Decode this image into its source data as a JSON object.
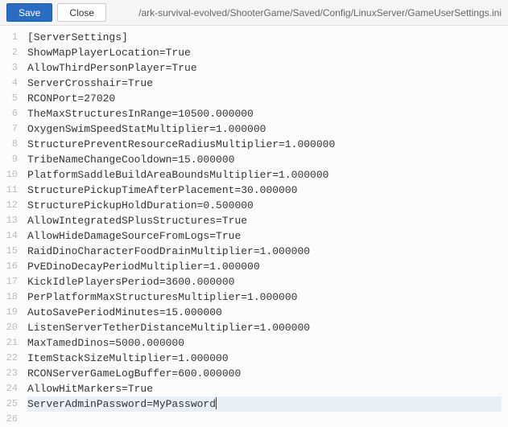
{
  "toolbar": {
    "save_label": "Save",
    "close_label": "Close",
    "file_path": "/ark-survival-evolved/ShooterGame/Saved/Config/LinuxServer/GameUserSettings.ini"
  },
  "editor": {
    "highlighted_index": 24,
    "lines": [
      "[ServerSettings]",
      "ShowMapPlayerLocation=True",
      "AllowThirdPersonPlayer=True",
      "ServerCrosshair=True",
      "RCONPort=27020",
      "TheMaxStructuresInRange=10500.000000",
      "OxygenSwimSpeedStatMultiplier=1.000000",
      "StructurePreventResourceRadiusMultiplier=1.000000",
      "TribeNameChangeCooldown=15.000000",
      "PlatformSaddleBuildAreaBoundsMultiplier=1.000000",
      "StructurePickupTimeAfterPlacement=30.000000",
      "StructurePickupHoldDuration=0.500000",
      "AllowIntegratedSPlusStructures=True",
      "AllowHideDamageSourceFromLogs=True",
      "RaidDinoCharacterFoodDrainMultiplier=1.000000",
      "PvEDinoDecayPeriodMultiplier=1.000000",
      "KickIdlePlayersPeriod=3600.000000",
      "PerPlatformMaxStructuresMultiplier=1.000000",
      "AutoSavePeriodMinutes=15.000000",
      "ListenServerTetherDistanceMultiplier=1.000000",
      "MaxTamedDinos=5000.000000",
      "ItemStackSizeMultiplier=1.000000",
      "RCONServerGameLogBuffer=600.000000",
      "AllowHitMarkers=True",
      "ServerAdminPassword=MyPassword",
      ""
    ]
  }
}
